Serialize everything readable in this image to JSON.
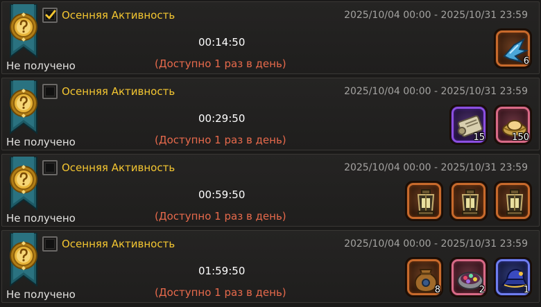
{
  "colors": {
    "title": "#f4c631",
    "dates": "#a4a3a1",
    "note": "#e86a4c",
    "status": "#e2e1df"
  },
  "quests": [
    {
      "title": "Осенняя Активность",
      "dates": "2025/10/04 00:00 - 2025/10/31 23:59",
      "timer": "00:14:50",
      "status": "Не получено",
      "note": "(Доступно 1 раз в день)",
      "checked": true,
      "rewards": [
        {
          "icon": "blue-wing-fragment-icon",
          "rarity": "orange",
          "count": "6"
        }
      ]
    },
    {
      "title": "Осенняя Активность",
      "dates": "2025/10/04 00:00 - 2025/10/31 23:59",
      "timer": "00:29:50",
      "status": "Не получено",
      "note": "(Доступно 1 раз в день)",
      "checked": false,
      "rewards": [
        {
          "icon": "scroll-icon",
          "rarity": "purple",
          "count": "15"
        },
        {
          "icon": "gold-ingot-icon",
          "rarity": "pink",
          "count": "150"
        }
      ]
    },
    {
      "title": "Осенняя Активность",
      "dates": "2025/10/04 00:00 - 2025/10/31 23:59",
      "timer": "00:59:50",
      "status": "Не получено",
      "note": "(Доступно 1 раз в день)",
      "checked": false,
      "rewards": [
        {
          "icon": "lantern-icon",
          "rarity": "orange",
          "count": ""
        },
        {
          "icon": "lantern-icon",
          "rarity": "orange",
          "count": ""
        },
        {
          "icon": "lantern-icon",
          "rarity": "orange",
          "count": ""
        }
      ]
    },
    {
      "title": "Осенняя Активность",
      "dates": "2025/10/04 00:00 - 2025/10/31 23:59",
      "timer": "01:59:50",
      "status": "Не получено",
      "note": "(Доступно 1 раз в день)",
      "checked": false,
      "rewards": [
        {
          "icon": "pouch-icon",
          "rarity": "orange",
          "count": "8"
        },
        {
          "icon": "gem-bowl-icon",
          "rarity": "pink",
          "count": "2"
        },
        {
          "icon": "blue-hat-icon",
          "rarity": "blue",
          "count": "1"
        }
      ]
    }
  ]
}
